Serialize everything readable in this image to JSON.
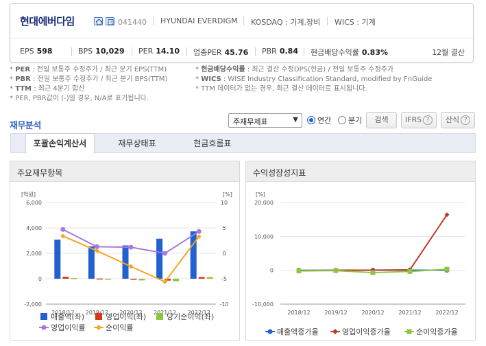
{
  "company": {
    "name": "현대에버다임",
    "code": "041440",
    "name_en": "HYUNDAI EVERDIGM",
    "market": "KOSDAQ : 기계.장비",
    "wics": "WICS : 기계",
    "icons": [
      "home-icon",
      "building-icon"
    ]
  },
  "stats": {
    "eps": {
      "label": "EPS",
      "value": "598"
    },
    "bps": {
      "label": "BPS",
      "value": "10,029"
    },
    "per": {
      "label": "PER",
      "value": "14.10"
    },
    "sector_per": {
      "label": "업종PER",
      "value": "45.76"
    },
    "pbr": {
      "label": "PBR",
      "value": "0.84"
    },
    "dividend_yield": {
      "label": "현금배당수익률",
      "value": "0.83%"
    },
    "settlement": "12월 결산"
  },
  "notes": {
    "per": {
      "key": "PER",
      "text": ": 전일 보통주 수정주가 / 최근 분기 EPS(TTM)"
    },
    "pbr": {
      "key": "PBR",
      "text": ": 전일 보통주 수정주가 / 최근 분기 BPS(TTM)"
    },
    "ttm": {
      "key": "TTM",
      "text": ": 최근 4분기 합산"
    },
    "negative": "* PER, PBR값이 (-)일 경우, N/A로 표기됩니다.",
    "dividend": {
      "key": "현금배당수익률",
      "text": ": 최근 결산 수정DPS(현금) / 전일 보통주 수정주가"
    },
    "wics": {
      "key": "WICS",
      "text": ": WISE Industry Classification Standard, modified by FnGuide"
    },
    "ttm_missing": "* TTM 데이터가 없는 경우, 최근 결산 데이터로 표시됩니다."
  },
  "finance": {
    "title": "재무분석",
    "select_value": "주재무제표",
    "period_annual": "연간",
    "period_quarter": "분기",
    "search_button": "검색",
    "ifrs_button": "IFRS",
    "formula_button": "산식",
    "tabs": [
      "포괄손익계산서",
      "재무상태표",
      "현금흐름표"
    ]
  },
  "colors": {
    "revenue": "#2161d1",
    "op_income": "#d63a1a",
    "net_income": "#8dc63f",
    "op_margin": "#a877e0",
    "net_margin": "#f5a623",
    "rev_growth": "#2161d1",
    "op_growth": "#c0392b",
    "net_growth": "#8dc63f"
  },
  "chart_data": [
    {
      "type": "bar",
      "title": "주요재무항목",
      "x": [
        "2018/12",
        "2019/12",
        "2020/12",
        "2021/12",
        "2022/12"
      ],
      "y_left_unit": "[억원]",
      "y_right_unit": "[%]",
      "ylim_left": [
        -2000,
        6000
      ],
      "yticks_left": [
        "6,000",
        "4,000",
        "2,000",
        "0",
        "-2,000"
      ],
      "ylim_right": [
        -10,
        10
      ],
      "yticks_right": [
        "10",
        "5",
        "0",
        "-5",
        "-10"
      ],
      "bar_series": [
        {
          "name": "매출액(좌)",
          "values": [
            3080,
            2550,
            2620,
            3150,
            3730
          ]
        },
        {
          "name": "영업이익(좌)",
          "values": [
            150,
            20,
            -20,
            -150,
            130
          ]
        },
        {
          "name": "당기순이익(좌)",
          "values": [
            50,
            -50,
            -130,
            -200,
            130
          ]
        }
      ],
      "line_series": [
        {
          "name": "영업이익률",
          "values": [
            4.7,
            1.3,
            1.2,
            0.0,
            4.3
          ]
        },
        {
          "name": "순이익률",
          "values": [
            3.4,
            0.5,
            -2.6,
            -5.6,
            3.3
          ]
        }
      ]
    },
    {
      "type": "line",
      "title": "수익성장성지표",
      "x": [
        "2018/12",
        "2019/12",
        "2020/12",
        "2021/12",
        "2022/12"
      ],
      "y_unit": "[%]",
      "ylim": [
        -10000,
        20000
      ],
      "yticks": [
        "20,000",
        "10,000",
        "0",
        "-10,000"
      ],
      "series": [
        {
          "name": "매출액증가율",
          "values": [
            -10,
            0,
            20,
            30,
            10
          ]
        },
        {
          "name": "영업이익증가율",
          "values": [
            -150,
            20,
            30,
            140,
            16400
          ]
        },
        {
          "name": "순이익증가율",
          "values": [
            -200,
            -100,
            -700,
            -350,
            300
          ]
        }
      ]
    }
  ]
}
